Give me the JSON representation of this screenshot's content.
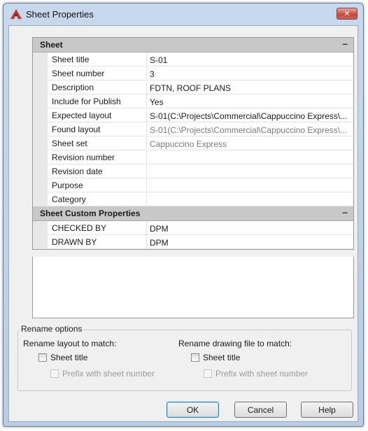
{
  "window": {
    "title": "Sheet Properties",
    "close_glyph": "✕"
  },
  "sheet_section": {
    "label": "Sheet",
    "toggle": "–",
    "rows": [
      {
        "name": "Sheet title",
        "value": "S-01"
      },
      {
        "name": "Sheet number",
        "value": "3"
      },
      {
        "name": "Description",
        "value": "FDTN, ROOF PLANS"
      },
      {
        "name": "Include for Publish",
        "value": "Yes"
      },
      {
        "name": "Expected layout",
        "value": "S-01(C:\\Projects\\Commercial\\Cappuccino Express\\..."
      },
      {
        "name": "Found layout",
        "value": "S-01(C:\\Projects\\Commercial\\Cappuccino Express\\..."
      },
      {
        "name": "Sheet set",
        "value": "Cappuccino Express"
      },
      {
        "name": "Revision number",
        "value": ""
      },
      {
        "name": "Revision date",
        "value": ""
      },
      {
        "name": "Purpose",
        "value": ""
      },
      {
        "name": "Category",
        "value": ""
      }
    ]
  },
  "custom_section": {
    "label": "Sheet Custom Properties",
    "toggle": "–",
    "rows": [
      {
        "name": "CHECKED BY",
        "value": "DPM"
      },
      {
        "name": "DRAWN BY",
        "value": "DPM"
      }
    ]
  },
  "rename_options": {
    "legend": "Rename options",
    "layout_column": {
      "label": "Rename layout to match:",
      "sheet_title": "Sheet title",
      "prefix": "Prefix with sheet number"
    },
    "drawing_column": {
      "label": "Rename drawing file to match:",
      "sheet_title": "Sheet title",
      "prefix": "Prefix with sheet number"
    }
  },
  "buttons": {
    "ok": "OK",
    "cancel": "Cancel",
    "help": "Help"
  },
  "colors": {
    "accent_red": "#c0392b",
    "category_bg": "#c8c8c8"
  }
}
